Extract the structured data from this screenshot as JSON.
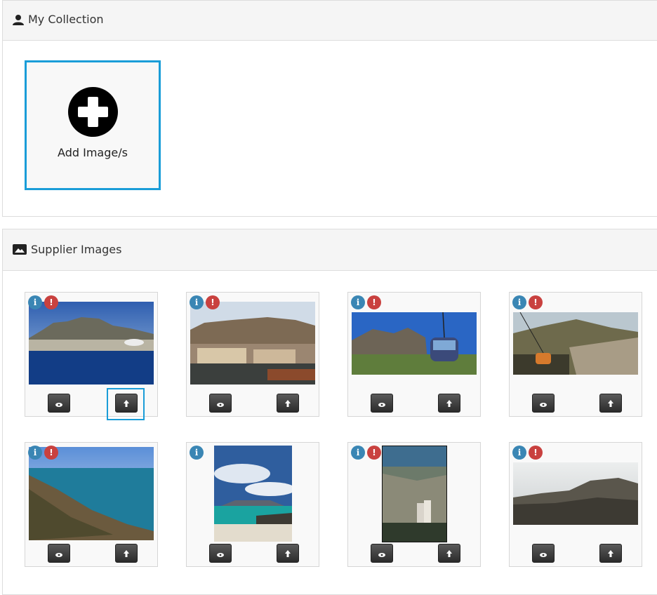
{
  "my_collection": {
    "title": "My Collection",
    "title_icon": "user-icon",
    "add_tile": {
      "label": "Add Image/s",
      "icon": "plus-circle-icon"
    }
  },
  "supplier_images": {
    "title": "Supplier Images",
    "title_icon": "image-icon",
    "cards": [
      {
        "info": "i",
        "warn": "!",
        "has_warn": true,
        "scene": "cape-town-waterfront-aerial"
      },
      {
        "info": "i",
        "warn": "!",
        "has_warn": true,
        "scene": "table-mountain-harbour"
      },
      {
        "info": "i",
        "warn": "!",
        "has_warn": true,
        "scene": "cable-car-rocks"
      },
      {
        "info": "i",
        "warn": "!",
        "has_warn": true,
        "scene": "cable-car-city-view"
      },
      {
        "info": "i",
        "warn": "!",
        "has_warn": true,
        "scene": "coastline-cliffs"
      },
      {
        "info": "i",
        "warn": "",
        "has_warn": false,
        "scene": "beach-table-mountain"
      },
      {
        "info": "i",
        "warn": "!",
        "has_warn": true,
        "scene": "hikers-city-view"
      },
      {
        "info": "i",
        "warn": "!",
        "has_warn": true,
        "scene": "mountain-summit"
      }
    ]
  },
  "colors": {
    "accent": "#1a9dd8",
    "info": "#3a86b4",
    "warn": "#c9413f"
  }
}
